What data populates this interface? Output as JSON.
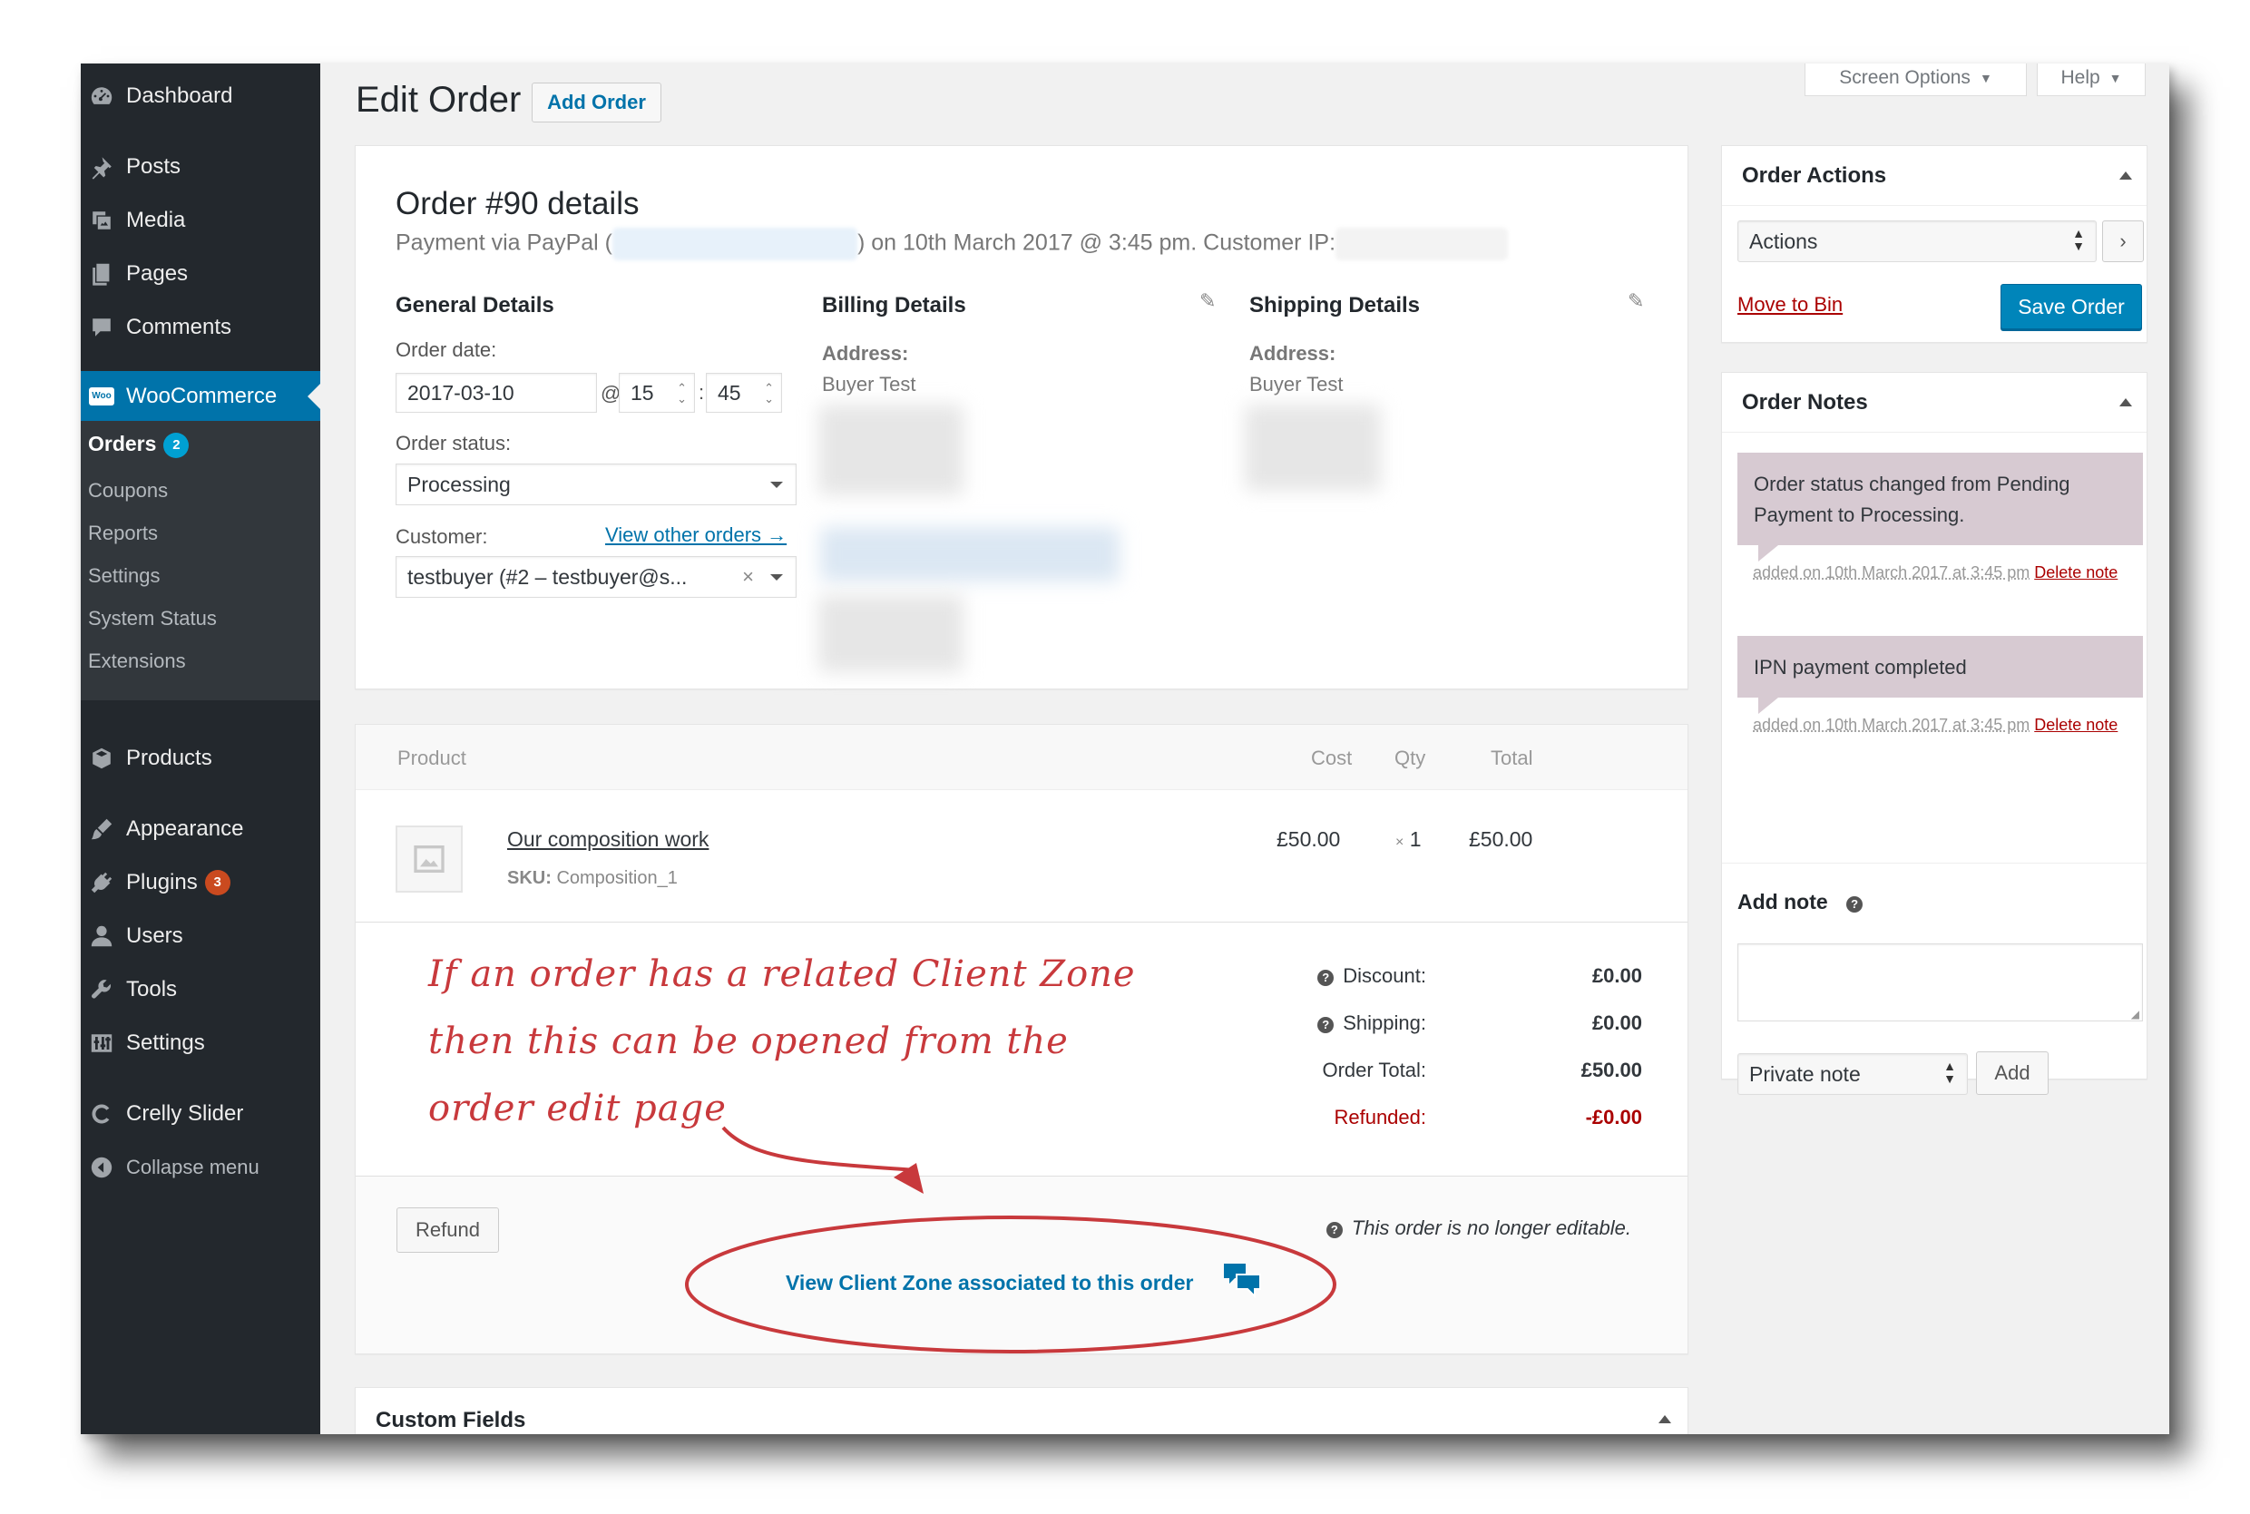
{
  "sidebar": {
    "menu": [
      {
        "label": "Dashboard",
        "icon": "dashboard-icon"
      },
      {
        "label": "Posts",
        "icon": "pin-icon"
      },
      {
        "label": "Media",
        "icon": "media-icon"
      },
      {
        "label": "Pages",
        "icon": "pages-icon"
      },
      {
        "label": "Comments",
        "icon": "comment-icon"
      },
      {
        "label": "WooCommerce",
        "icon": "woo-icon"
      },
      {
        "label": "Products",
        "icon": "archive-icon"
      },
      {
        "label": "Appearance",
        "icon": "brush-icon"
      },
      {
        "label": "Plugins",
        "icon": "plug-icon",
        "badge": "3"
      },
      {
        "label": "Users",
        "icon": "users-icon"
      },
      {
        "label": "Tools",
        "icon": "wrench-icon"
      },
      {
        "label": "Settings",
        "icon": "sliders-icon"
      },
      {
        "label": "Crelly Slider",
        "icon": "crelly-icon"
      },
      {
        "label": "Collapse menu",
        "icon": "collapse-icon"
      }
    ],
    "woo_badge": "Woo",
    "submenu": [
      {
        "label": "Orders",
        "badge": "2"
      },
      {
        "label": "Coupons"
      },
      {
        "label": "Reports"
      },
      {
        "label": "Settings"
      },
      {
        "label": "System Status"
      },
      {
        "label": "Extensions"
      }
    ]
  },
  "header": {
    "title": "Edit Order",
    "add_order": "Add Order",
    "screen_options": "Screen Options",
    "help": "Help"
  },
  "order": {
    "title": "Order #90 details",
    "payment_prefix": "Payment via PayPal (",
    "payment_mid": ") on 10th March 2017 @ 3:45 pm. Customer IP:",
    "general": {
      "title": "General Details",
      "order_date_label": "Order date:",
      "date": "2017-03-10",
      "at": "@",
      "hour": "15",
      "colon": ":",
      "minute": "45",
      "status_label": "Order status:",
      "status": "Processing",
      "customer_label": "Customer:",
      "view_other": "View other orders →",
      "customer": "testbuyer (#2 – testbuyer@s...",
      "clear": "×"
    },
    "billing": {
      "title": "Billing Details",
      "address_label": "Address:",
      "name": "Buyer Test"
    },
    "shipping": {
      "title": "Shipping Details",
      "address_label": "Address:",
      "name": "Buyer Test"
    }
  },
  "items": {
    "headers": {
      "product": "Product",
      "cost": "Cost",
      "qty": "Qty",
      "total": "Total"
    },
    "rows": [
      {
        "name": "Our composition work",
        "sku_label": "SKU:",
        "sku": "Composition_1",
        "cost": "£50.00",
        "qty_x": "×",
        "qty": "1",
        "total": "£50.00"
      }
    ],
    "totals": {
      "discount_label": "Discount:",
      "discount": "£0.00",
      "shipping_label": "Shipping:",
      "shipping": "£0.00",
      "order_total_label": "Order Total:",
      "order_total": "£50.00",
      "refunded_label": "Refunded:",
      "refunded": "-£0.00"
    },
    "refund_button": "Refund",
    "not_editable": "This order is no longer editable.",
    "client_zone_link": "View Client Zone associated to this order"
  },
  "annotation": {
    "line1": "If an order has a related Client Zone",
    "line2": "then this can be opened from the",
    "line3": "order edit page"
  },
  "custom_fields": {
    "title": "Custom Fields"
  },
  "order_actions": {
    "title": "Order Actions",
    "select": "Actions",
    "move_to_bin": "Move to Bin",
    "save": "Save Order"
  },
  "order_notes": {
    "title": "Order Notes",
    "notes": [
      {
        "text": "Order status changed from Pending Payment to Processing.",
        "meta": "added on 10th March 2017 at 3:45 pm",
        "delete": "Delete note"
      },
      {
        "text": "IPN payment completed",
        "meta": "added on 10th March 2017 at 3:45 pm",
        "delete": "Delete note"
      }
    ],
    "add_note_label": "Add note",
    "note_type": "Private note",
    "add_button": "Add"
  },
  "colors": {
    "accent": "#0073aa",
    "sidebar": "#23282d",
    "note": "#d7cad2",
    "annotation": "#c8393c",
    "danger": "#aa0000"
  }
}
